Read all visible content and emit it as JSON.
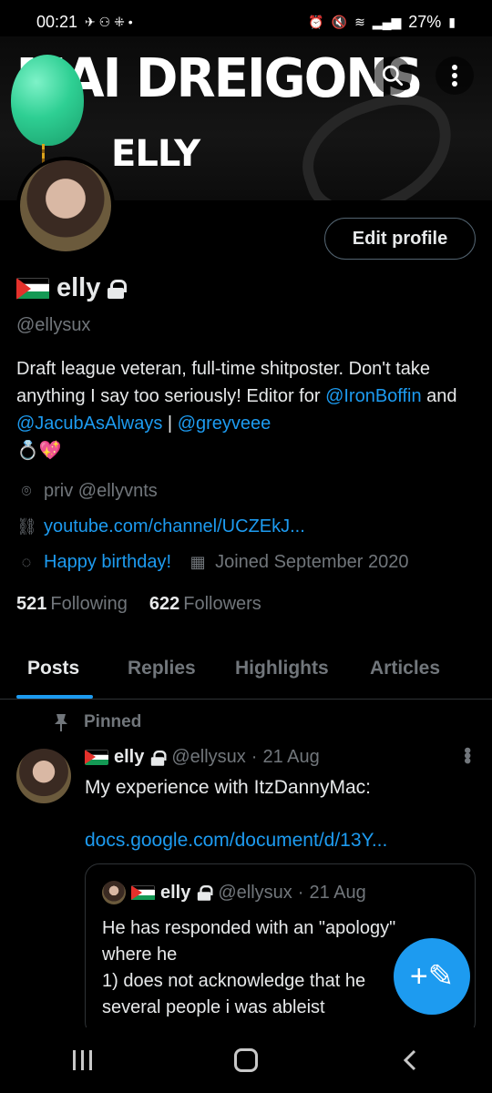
{
  "status_bar": {
    "time": "00:21",
    "notif_icons": "✈ ⚇ ⁜ •",
    "battery": "27%"
  },
  "banner": {
    "title": "MAI DREIGONS",
    "subtitle": "ELLY"
  },
  "profile": {
    "edit_label": "Edit profile",
    "name": "elly",
    "handle": "@ellysux",
    "bio_pre": "Draft league veteran, full-time shitposter. Don't take anything I say too seriously! Editor for ",
    "bio_link1": "@IronBoffin",
    "bio_mid": " and ",
    "bio_link2": "@JacubAsAlways",
    "bio_sep": " | ",
    "bio_link3": "@greyveee",
    "bio_emoji": "💍💖",
    "location": "priv @ellyvnts",
    "website": "youtube.com/channel/UCZEkJ...",
    "birthday": "Happy birthday!",
    "joined": "Joined September 2020",
    "following_count": "521",
    "following_label": "Following",
    "followers_count": "622",
    "followers_label": "Followers"
  },
  "tabs": [
    "Posts",
    "Replies",
    "Highlights",
    "Articles"
  ],
  "pinned": {
    "label": "Pinned",
    "name": "elly",
    "handle": "@ellysux",
    "dot": "·",
    "date": "21 Aug",
    "text": "My experience with ItzDannyMac:",
    "link": "docs.google.com/document/d/13Y..."
  },
  "quote": {
    "name": "elly",
    "handle": "@ellysux",
    "dot": "·",
    "date": "21 Aug",
    "text": "He has responded with an \"apology\" where he\n1) does not acknowledge that he\nseveral people i was ableist"
  },
  "fab_icon": "+✎",
  "colors": {
    "accent": "#1d9bf0",
    "background": "#000000",
    "text": "#e7e9ea",
    "muted": "#71767b",
    "border": "#2f3336"
  },
  "icons": {
    "search": "search-icon",
    "more": "more-vertical-icon",
    "lock": "lock-icon",
    "location": "location-pin-icon",
    "link": "link-icon",
    "balloon": "balloon-icon",
    "calendar": "calendar-icon",
    "pin": "pin-icon",
    "compose": "compose-icon"
  }
}
